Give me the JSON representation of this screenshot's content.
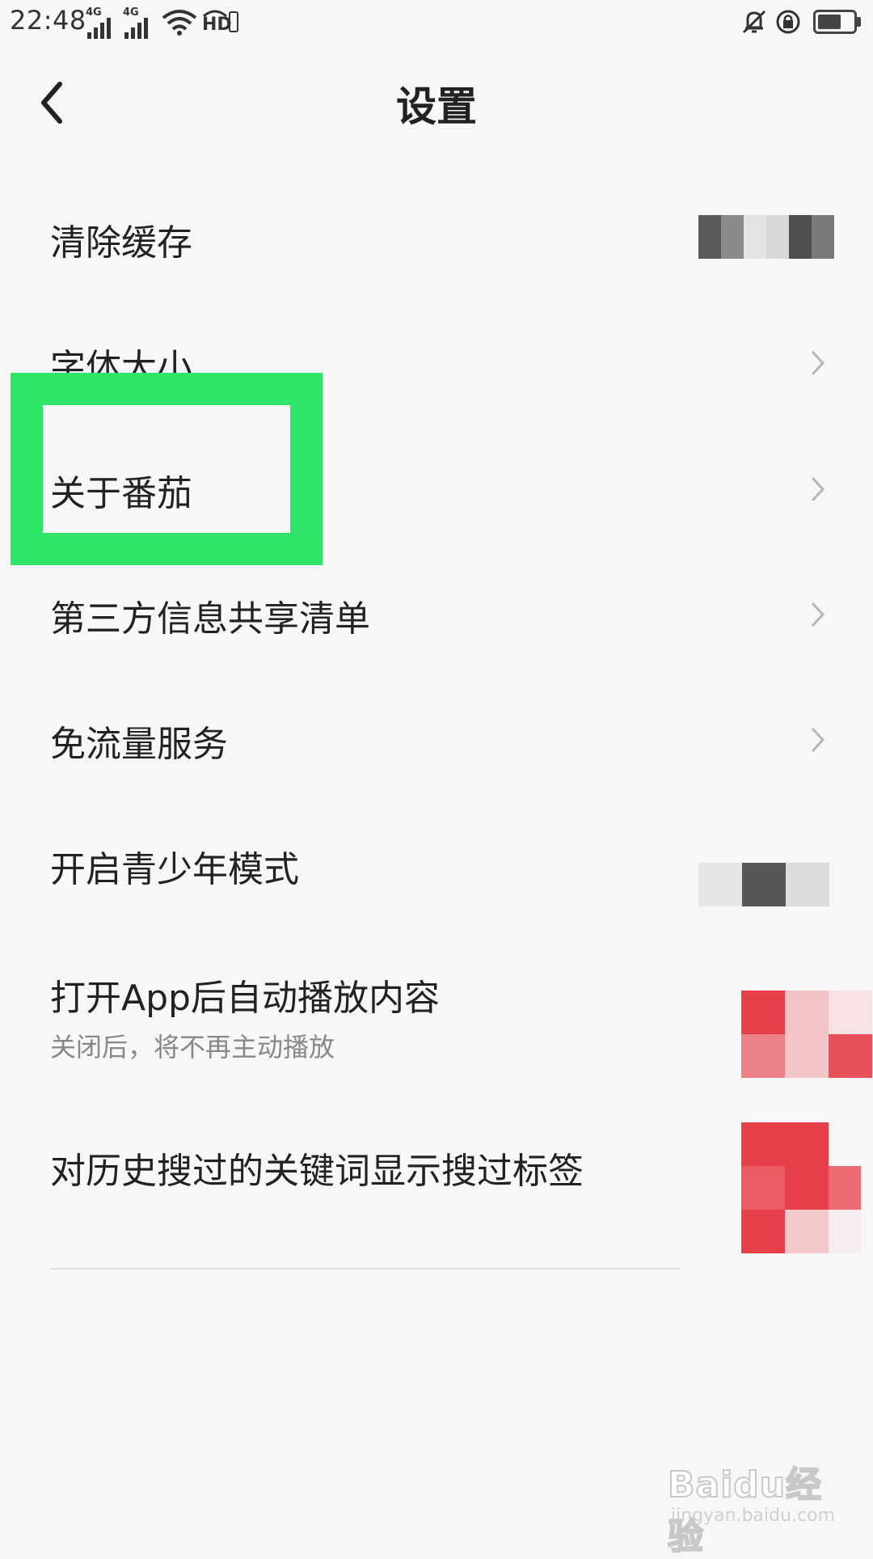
{
  "status_bar": {
    "time": "22:48",
    "network_1": "4G",
    "network_2": "4G",
    "hd_label": "HD",
    "icons": [
      "signal-bars-icon",
      "wifi-icon",
      "hd-icon",
      "bell-muted-icon",
      "rotation-lock-icon",
      "battery-icon"
    ]
  },
  "header": {
    "title": "设置",
    "back_icon": "chevron-left-icon"
  },
  "settings": {
    "items": [
      {
        "label": "清除缓存",
        "trailing": "value-pixelated"
      },
      {
        "label": "字体大小",
        "trailing": "chevron-right-icon"
      },
      {
        "label": "关于番茄",
        "trailing": "chevron-right-icon"
      },
      {
        "label": "第三方信息共享清单",
        "trailing": "chevron-right-icon"
      },
      {
        "label": "免流量服务",
        "trailing": "chevron-right-icon"
      },
      {
        "label": "开启青少年模式",
        "trailing": "toggle-pixelated"
      },
      {
        "label": "打开App后自动播放内容",
        "sublabel": "关闭后，将不再主动播放",
        "trailing": "toggle-pixelated"
      },
      {
        "label": "对历史搜过的关键词显示搜过标签",
        "trailing": "toggle-pixelated"
      }
    ]
  },
  "annotation": {
    "highlight_color": "#2ee469",
    "highlighted_item": "关于番茄"
  },
  "watermark": {
    "logo": "Baidu经验",
    "url": "jingyan.baidu.com"
  },
  "colors": {
    "background": "#f7f7f7",
    "text": "#222222",
    "subtext": "#888888",
    "accent_red": "#e8404a"
  }
}
